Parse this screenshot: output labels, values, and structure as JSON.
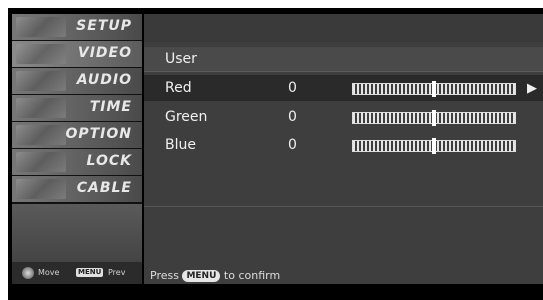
{
  "menu": {
    "items": [
      {
        "label": "SETUP"
      },
      {
        "label": "VIDEO"
      },
      {
        "label": "AUDIO"
      },
      {
        "label": "TIME"
      },
      {
        "label": "OPTION"
      },
      {
        "label": "LOCK"
      },
      {
        "label": "CABLE"
      }
    ],
    "footer": {
      "move_label": "Move",
      "menu_key": "MENU",
      "prev_label": "Prev"
    }
  },
  "panel": {
    "title": "User",
    "rows": [
      {
        "name": "Red",
        "value": "0",
        "level_percent": 50
      },
      {
        "name": "Green",
        "value": "0",
        "level_percent": 50
      },
      {
        "name": "Blue",
        "value": "0",
        "level_percent": 50
      }
    ],
    "hint": {
      "prefix": "Press",
      "key": "MENU",
      "suffix": "to confirm"
    }
  },
  "colors": {
    "panel_bg": "#3e3e3e",
    "selected_row_bg": "#2a2a2a",
    "text": "#f0f0f0"
  }
}
